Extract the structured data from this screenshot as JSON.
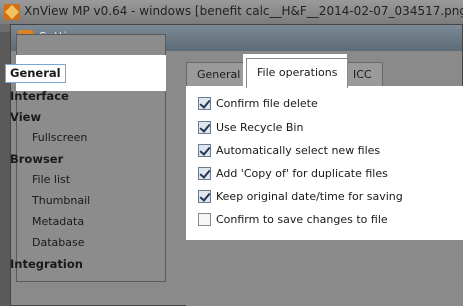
{
  "app": {
    "title": "XnView MP v0.64 - windows [benefit calc__H&F__2014-02-07_034517.png]"
  },
  "dialog": {
    "title": "Settings"
  },
  "categories": [
    {
      "label": "General",
      "level": "top",
      "selected": true
    },
    {
      "label": "Interface",
      "level": "top"
    },
    {
      "label": "View",
      "level": "top"
    },
    {
      "label": "Fullscreen",
      "level": "sub"
    },
    {
      "label": "Browser",
      "level": "top"
    },
    {
      "label": "File list",
      "level": "sub"
    },
    {
      "label": "Thumbnail",
      "level": "sub"
    },
    {
      "label": "Metadata",
      "level": "sub"
    },
    {
      "label": "Database",
      "level": "sub"
    },
    {
      "label": "Integration",
      "level": "top"
    }
  ],
  "tabs": [
    {
      "label": "General",
      "active": false
    },
    {
      "label": "File operations",
      "active": true
    },
    {
      "label": "ICC",
      "active": false
    }
  ],
  "options": [
    {
      "label": "Confirm file delete",
      "checked": true
    },
    {
      "label": "Use Recycle Bin",
      "checked": true
    },
    {
      "label": "Automatically select new files",
      "checked": true
    },
    {
      "label": "Add 'Copy of' for duplicate files",
      "checked": true
    },
    {
      "label": "Keep original date/time for saving",
      "checked": true
    },
    {
      "label": "Confirm to save changes to file",
      "checked": false
    }
  ]
}
